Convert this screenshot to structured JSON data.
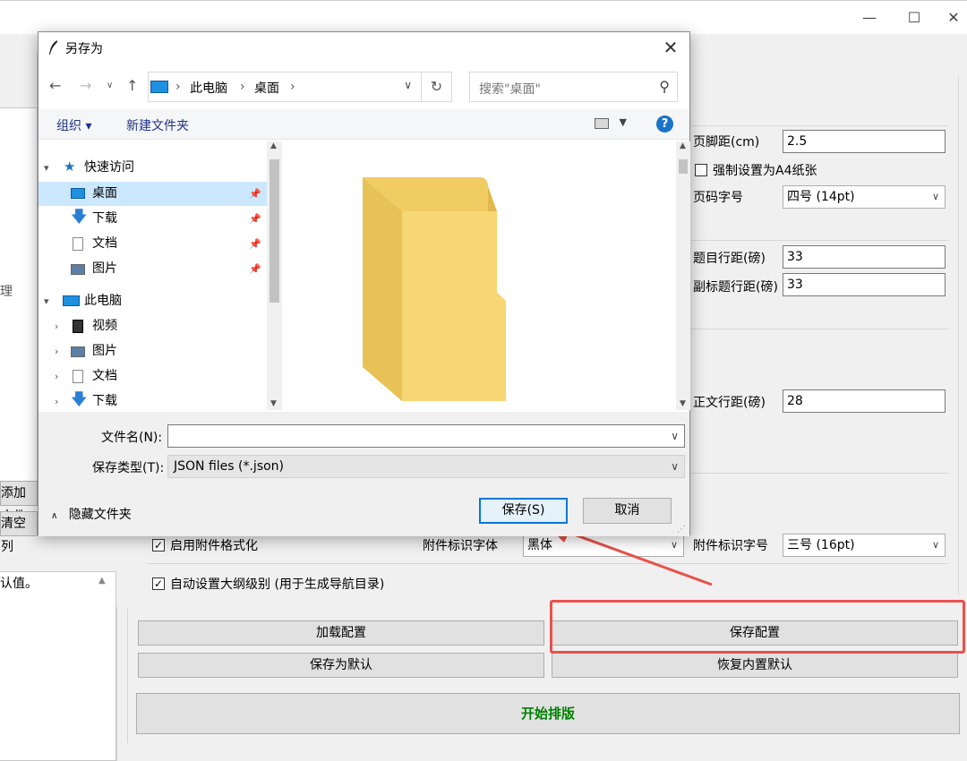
{
  "app": {
    "left_fragments": {
      "fragment_1": "理",
      "add_files": "添加文件",
      "clear_list": "清空列",
      "default_text": "认值。"
    },
    "fields": {
      "footer_margin_label": "页脚距(cm)",
      "footer_margin_value": "2.5",
      "force_a4_label": "强制设置为A4纸张",
      "force_a4_checked": false,
      "page_num_size_label": "页码字号",
      "page_num_size_value": "四号 (14pt)",
      "title_spacing_label": "题目行距(磅)",
      "title_spacing_value": "33",
      "subtitle_spacing_label": "副标题行距(磅)",
      "subtitle_spacing_value": "33",
      "body_spacing_label": "正文行距(磅)",
      "body_spacing_value": "28",
      "enable_attachment_label": "启用附件格式化",
      "enable_attachment_checked": true,
      "attachment_font_label": "附件标识字体",
      "attachment_font_value": "黑体",
      "attachment_size_label": "附件标识字号",
      "attachment_size_value": "三号 (16pt)",
      "outline_level_label": "自动设置大纲级别 (用于生成导航目录)",
      "outline_level_checked": true
    },
    "buttons": {
      "load_config": "加载配置",
      "save_config": "保存配置",
      "save_default": "保存为默认",
      "restore_default": "恢复内置默认",
      "start": "开始排版"
    }
  },
  "dialog": {
    "title": "另存为",
    "breadcrumb": [
      "此电脑",
      "桌面"
    ],
    "search_placeholder": "搜索\"桌面\"",
    "toolbar": {
      "organize": "组织 ▾",
      "new_folder": "新建文件夹"
    },
    "nav_tree": [
      {
        "label": "快速访问",
        "level": 0,
        "caret": "▾",
        "icon": "star-icon"
      },
      {
        "label": "桌面",
        "level": 1,
        "pinned": true,
        "icon": "desktop-icon",
        "selected": true
      },
      {
        "label": "下载",
        "level": 1,
        "pinned": true,
        "icon": "download-icon"
      },
      {
        "label": "文档",
        "level": 1,
        "pinned": true,
        "icon": "document-icon"
      },
      {
        "label": "图片",
        "level": 1,
        "pinned": true,
        "icon": "pictures-icon"
      },
      {
        "label": "此电脑",
        "level": 0,
        "caret": "▾",
        "icon": "computer-icon"
      },
      {
        "label": "视频",
        "level": 1,
        "caret": "›",
        "icon": "video-icon"
      },
      {
        "label": "图片",
        "level": 1,
        "caret": "›",
        "icon": "pictures-icon"
      },
      {
        "label": "文档",
        "level": 1,
        "caret": "›",
        "icon": "document-icon"
      },
      {
        "label": "下载",
        "level": 1,
        "caret": "›",
        "icon": "download-icon"
      }
    ],
    "filename_label": "文件名(N):",
    "filename_value": "",
    "filetype_label": "保存类型(T):",
    "filetype_value": "JSON files (*.json)",
    "hide_folders": "隐藏文件夹",
    "save": "保存(S)",
    "cancel": "取消"
  },
  "annotation_color": "#e8524a"
}
